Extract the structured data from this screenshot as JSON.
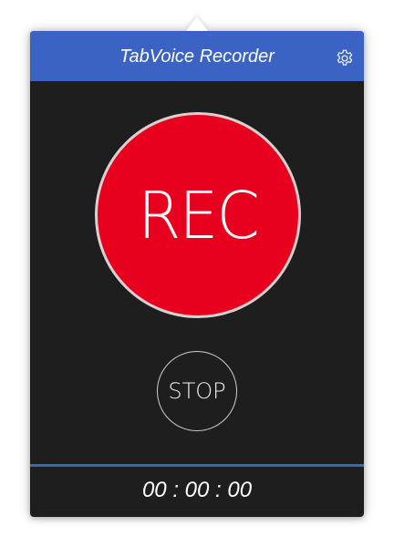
{
  "header": {
    "title": "TabVoice Recorder",
    "settings_icon": "gear-icon",
    "color": "#3a63c4"
  },
  "controls": {
    "rec_label": "REC",
    "rec_color": "#e8001f",
    "stop_label": "STOP"
  },
  "status": {
    "timer": "00 : 00 : 00",
    "progress": 1.0
  }
}
